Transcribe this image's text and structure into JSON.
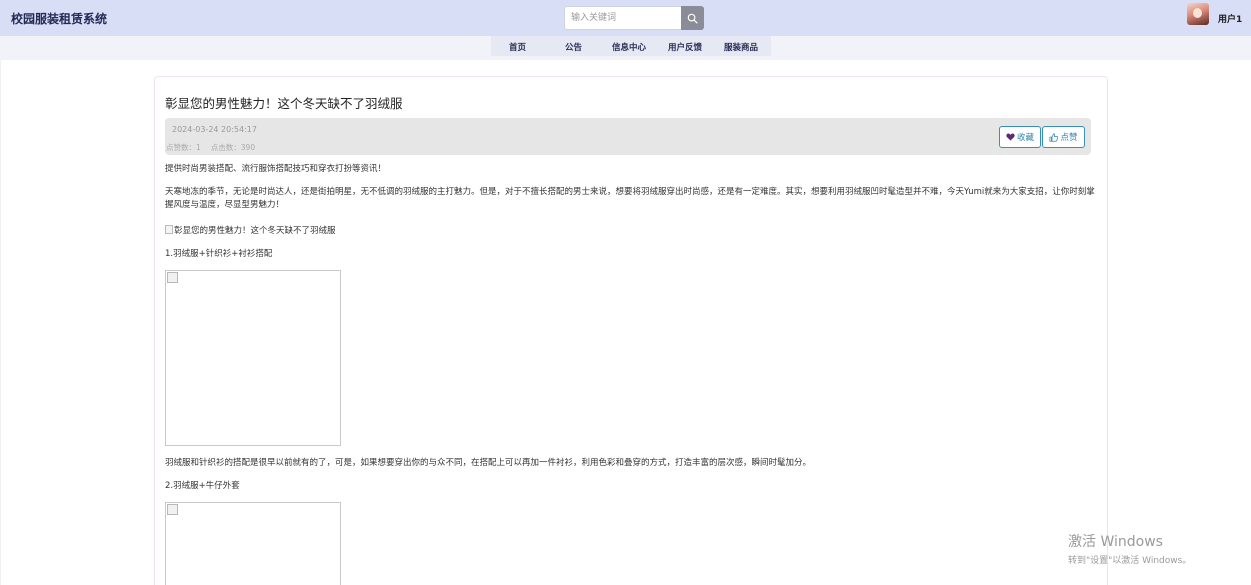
{
  "header": {
    "brand": "校园服装租赁系统",
    "search_placeholder": "输入关键词",
    "search_icon": "search-icon",
    "username": "用户1"
  },
  "nav": {
    "items": [
      {
        "label": "首页"
      },
      {
        "label": "公告"
      },
      {
        "label": "信息中心"
      },
      {
        "label": "用户反馈"
      },
      {
        "label": "服装商品"
      }
    ]
  },
  "article": {
    "title": "彰显您的男性魅力！这个冬天缺不了羽绒服",
    "date": "2024-03-24 20:54:17",
    "likes": "点赞数：1",
    "clicks": "点击数：390",
    "favorite_label": "收藏",
    "favorite_icon": "heart-icon",
    "like_label": "点赞",
    "like_icon": "thumbs-up-icon",
    "intro": "提供时尚男装搭配、流行服饰搭配技巧和穿衣打扮等资讯！",
    "para1": "天寒地冻的季节，无论是时尚达人，还是街拍明星，无不低调的羽绒服的主打魅力。但是，对于不擅长搭配的男士来说，想要将羽绒服穿出时尚感，还是有一定难度。其实，想要利用羽绒服凹时髦造型并不难，今天Yumi就来为大家支招，让你时刻掌握风度与温度，尽显型男魅力！",
    "image_alt": "彰显您的男性魅力！这个冬天缺不了羽绒服",
    "section1": "1.羽绒服+针织衫+衬衫搭配",
    "para2": "羽绒服和针织衫的搭配是很早以前就有的了，可是，如果想要穿出你的与众不同，在搭配上可以再加一件衬衫，利用色彩和叠穿的方式，打造丰富的层次感，瞬间时髦加分。",
    "section2": "2.羽绒服+牛仔外套"
  },
  "watermark": {
    "title": "激活 Windows",
    "subtitle": "转到\"设置\"以激活 Windows。"
  },
  "colors": {
    "topbar": "#d9def7",
    "accent": "#3c8fb4",
    "meta_bg": "#e6e6e6",
    "heart": "#5a2a7a"
  }
}
